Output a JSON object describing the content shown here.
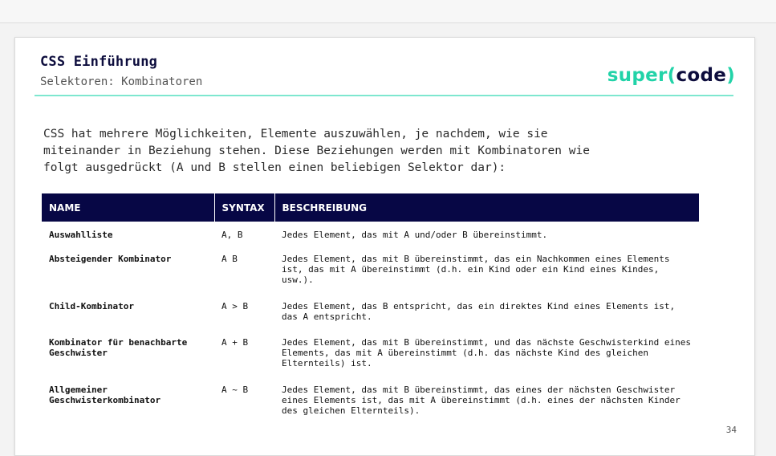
{
  "header": {
    "title": "CSS Einführung",
    "subtitle": "Selektoren: Kombinatoren",
    "logo": {
      "part1": "super",
      "open": "(",
      "part2": "code",
      "close": ")"
    }
  },
  "intro": "CSS hat mehrere Möglichkeiten, Elemente auszuwählen, je nachdem, wie sie miteinander in Beziehung stehen. Diese Beziehungen werden mit Kombinatoren wie folgt ausgedrückt (A und B stellen einen beliebigen Selektor dar):",
  "table": {
    "headers": {
      "name": "NAME",
      "syntax": "SYNTAX",
      "desc": "BESCHREIBUNG"
    },
    "rows": [
      {
        "name": "Auswahlliste",
        "syntax": "A, B",
        "desc": "Jedes Element, das mit A und/oder B übereinstimmt."
      },
      {
        "name": "Absteigender Kombinator",
        "syntax": "A B",
        "desc": "Jedes Element, das mit B übereinstimmt, das ein Nachkommen eines Elements ist, das mit A übereinstimmt (d.h. ein Kind oder ein Kind eines Kindes, usw.)."
      },
      {
        "name": "Child-Kombinator",
        "syntax": "A > B",
        "desc": "Jedes Element, das B entspricht, das ein direktes Kind eines Elements ist, das A entspricht."
      },
      {
        "name": "Kombinator für benachbarte Geschwister",
        "syntax": "A + B",
        "desc": "Jedes Element, das mit B übereinstimmt, und das nächste Geschwisterkind eines Elements, das mit A übereinstimmt (d.h. das nächste Kind des gleichen Elternteils) ist."
      },
      {
        "name": "Allgemeiner Geschwisterkombinator",
        "syntax": "A ~ B",
        "desc": "Jedes Element, das mit B übereinstimmt, das eines der nächsten Geschwister eines Elements ist, das mit A übereinstimmt (d.h. eines der nächsten Kinder des gleichen Elternteils)."
      }
    ]
  },
  "page_number": "34",
  "colors": {
    "accent": "#22d3a8",
    "header_bg": "#070745",
    "rule": "#7ee7cf"
  }
}
